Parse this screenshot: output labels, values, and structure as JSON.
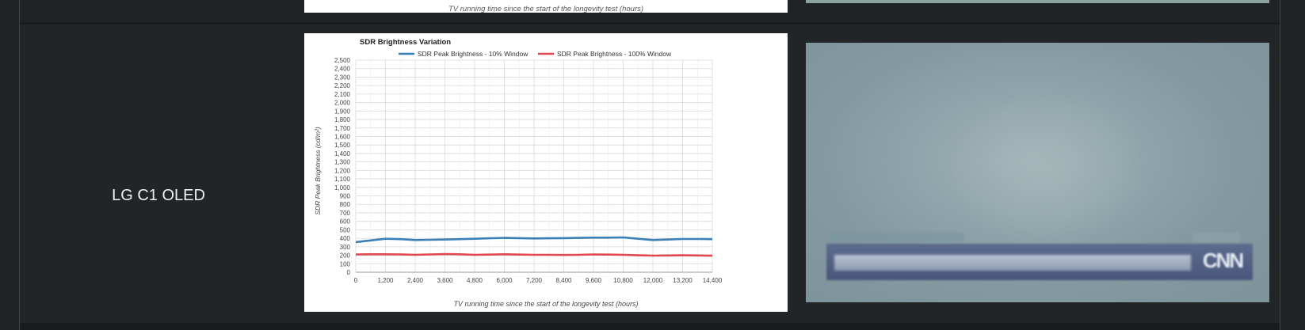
{
  "previous_row": {
    "chart_xlabel": "TV running time since the start of the longevity test (hours)"
  },
  "row": {
    "model": "LG C1 OLED"
  },
  "colors": {
    "series_10": "#3a7fb5",
    "series_100": "#e0474f",
    "grid": "#d8d8d8"
  },
  "chart_data": {
    "type": "line",
    "title": "SDR Brightness Variation",
    "xlabel": "TV running time since the start of the longevity test (hours)",
    "ylabel": "SDR Peak Brightness (cd/m²)",
    "x": [
      0,
      600,
      1200,
      1800,
      2400,
      3000,
      3600,
      4200,
      4800,
      5400,
      6000,
      6600,
      7200,
      7800,
      8400,
      9000,
      9600,
      10200,
      10800,
      11400,
      12000,
      12600,
      13200,
      13800,
      14400
    ],
    "xlim": [
      0,
      14400
    ],
    "ylim": [
      0,
      2500
    ],
    "x_ticks": [
      0,
      1200,
      2400,
      3600,
      4800,
      6000,
      7200,
      8400,
      9600,
      10800,
      12000,
      13200,
      14400
    ],
    "x_tick_labels": [
      "0",
      "1,200",
      "2,400",
      "3,600",
      "4,800",
      "6,000",
      "7,200",
      "8,400",
      "9,600",
      "10,800",
      "12,000",
      "13,200",
      "14,400"
    ],
    "y_ticks": [
      0,
      100,
      200,
      300,
      400,
      500,
      600,
      700,
      800,
      900,
      1000,
      1100,
      1200,
      1300,
      1400,
      1500,
      1600,
      1700,
      1800,
      1900,
      2000,
      2100,
      2200,
      2300,
      2400,
      2500
    ],
    "y_tick_labels": [
      "0",
      "100",
      "200",
      "300",
      "400",
      "500",
      "600",
      "700",
      "800",
      "900",
      "1,000",
      "1,100",
      "1,200",
      "1,300",
      "1,400",
      "1,500",
      "1,600",
      "1,700",
      "1,800",
      "1,900",
      "2,000",
      "2,100",
      "2,200",
      "2,300",
      "2,400",
      "2,500"
    ],
    "grid": true,
    "legend_position": "top",
    "series": [
      {
        "name": "SDR Peak Brightness - 10% Window",
        "color": "#3a7fb5",
        "values": [
          355,
          375,
          395,
          390,
          380,
          382,
          385,
          390,
          395,
          400,
          405,
          402,
          398,
          400,
          402,
          405,
          408,
          408,
          410,
          395,
          380,
          385,
          392,
          392,
          390
        ]
      },
      {
        "name": "SDR Peak Brightness - 100% Window",
        "color": "#e0474f",
        "values": [
          210,
          212,
          212,
          210,
          205,
          210,
          215,
          212,
          205,
          208,
          212,
          208,
          205,
          205,
          203,
          205,
          210,
          208,
          205,
          200,
          196,
          198,
          200,
          198,
          195
        ]
      }
    ]
  }
}
